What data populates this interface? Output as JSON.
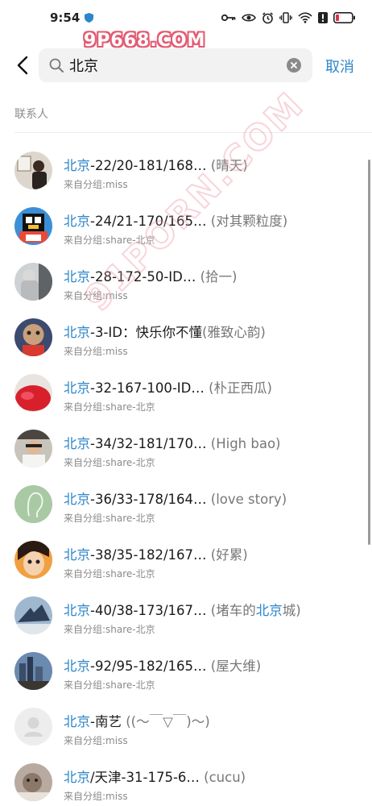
{
  "status": {
    "time": "9:54"
  },
  "watermark": {
    "top": "9P668.COM",
    "diagonal": "91PORN.COM"
  },
  "search": {
    "query": "北京",
    "cancel_label": "取消"
  },
  "section": {
    "title": "联系人"
  },
  "contacts": [
    {
      "hl": "北京",
      "name": "-22/20-181/168…",
      "remark": "(晴天)",
      "group": "来自分组:miss"
    },
    {
      "hl": "北京",
      "name": "-24/21-170/165…",
      "remark": "(对其颗粒度)",
      "group": "来自分组:share-北京"
    },
    {
      "hl": "北京",
      "name": "-28-172-50-ID…",
      "remark": "(拾一)",
      "group": "来自分组:miss"
    },
    {
      "hl": "北京",
      "name": "-3-ID：快乐你不懂",
      "remark": "(雅致心韵)",
      "group": "来自分组:miss"
    },
    {
      "hl": "北京",
      "name": "-32-167-100-ID…",
      "remark": "(朴正西瓜)",
      "group": "来自分组:share-北京"
    },
    {
      "hl": "北京",
      "name": "-34/32-181/170…",
      "remark": "(High bao)",
      "group": "来自分组:share-北京"
    },
    {
      "hl": "北京",
      "name": "-36/33-178/164…",
      "remark": "(love story)",
      "group": "来自分组:share-北京"
    },
    {
      "hl": "北京",
      "name": "-38/35-182/167…",
      "remark": "(好累)",
      "group": "来自分组:share-北京"
    },
    {
      "hl": "北京",
      "name": "-40/38-173/167…",
      "remark_pre": "(堵车的",
      "remark_hl": "北京",
      "remark_post": "城)",
      "group": "来自分组:share-北京"
    },
    {
      "hl": "北京",
      "name": "-92/95-182/165…",
      "remark": "(屋大维)",
      "group": "来自分组:share-北京"
    },
    {
      "hl": "北京",
      "name": "-南艺",
      "remark": "((～￣▽￣)～)",
      "group": "来自分组:miss"
    },
    {
      "hl": "北京",
      "name": "/天津-31-175-6…",
      "remark": "(cucu)",
      "group": "来自分组:miss"
    }
  ]
}
